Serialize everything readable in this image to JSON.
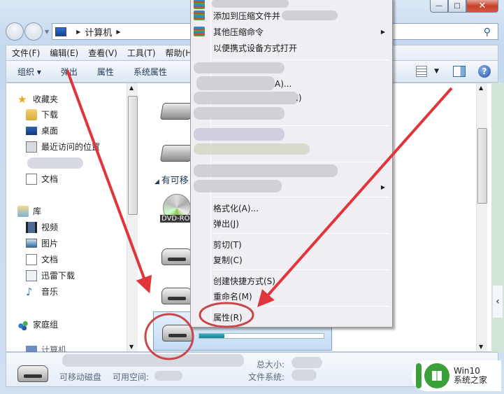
{
  "window": {
    "controls": {
      "minimize": "—",
      "maximize": "□",
      "close": "✕"
    }
  },
  "address_bar": {
    "crumbs": [
      "计算机"
    ]
  },
  "menubar": {
    "items": [
      "文件(F)",
      "编辑(E)",
      "查看(V)",
      "工具(T)",
      "帮助(H)"
    ]
  },
  "toolbar": {
    "organize": "组织 ▾",
    "eject": "弹出",
    "properties": "属性",
    "system_properties": "系统属性",
    "help": "?"
  },
  "sidebar": {
    "favorites": {
      "label": "收藏夹",
      "items": [
        "下载",
        "桌面",
        "最近访问的位置",
        "文档"
      ]
    },
    "libraries": {
      "label": "库",
      "items": [
        "视频",
        "图片",
        "文档",
        "迅雷下载",
        "音乐"
      ]
    },
    "homegroup": "家庭组",
    "computer": "计算机"
  },
  "main": {
    "removable_section": "有可移",
    "dvd_label": "DVD-ROM",
    "selected_drive_capacity_used_fraction": 0.2
  },
  "context_menu": {
    "items": [
      {
        "label": "添加到压缩文件并",
        "icon": "archive-icon"
      },
      {
        "label": "其他压缩命令",
        "icon": "archive-icon",
        "submenu": true
      },
      {
        "label": "以便携式设备方式打开"
      },
      {
        "label": "A)..."
      },
      {
        "label": ".)"
      },
      {
        "label": "格式化(A)..."
      },
      {
        "label": "弹出(J)"
      },
      {
        "label": "剪切(T)"
      },
      {
        "label": "复制(C)"
      },
      {
        "label": "创建快捷方式(S)"
      },
      {
        "label": "重命名(M)"
      },
      {
        "label": "属性(R)"
      }
    ]
  },
  "details_pane": {
    "drive_type": "可移动磁盘",
    "free_space_label": "可用空间:",
    "total_size_label": "总大小:",
    "file_system_label": "文件系统:"
  },
  "watermark": {
    "line1": "Win10",
    "line2": "系统之家"
  },
  "colors": {
    "annotation": "#e0353a",
    "capacity_fill": "#1f8ea6",
    "selection": "#c4dcf5"
  }
}
